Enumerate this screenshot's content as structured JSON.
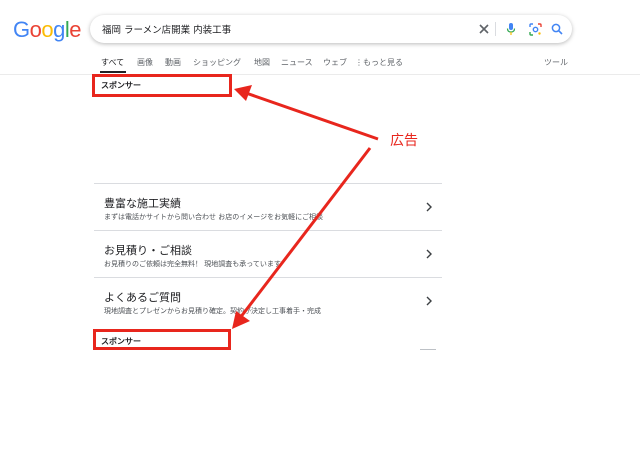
{
  "logo": {
    "letters": [
      "G",
      "o",
      "o",
      "g",
      "l",
      "e"
    ],
    "colors": [
      "#4285F4",
      "#EA4335",
      "#FBBC05",
      "#4285F4",
      "#34A853",
      "#EA4335"
    ]
  },
  "search": {
    "query": "福岡 ラーメン店開業 内装工事",
    "icons": [
      "clear-icon",
      "microphone-icon",
      "camera-lens-icon",
      "search-icon"
    ]
  },
  "tabs": [
    {
      "label": "すべて",
      "active": true
    },
    {
      "label": "画像"
    },
    {
      "label": "動画"
    },
    {
      "label": "ショッピング"
    },
    {
      "label": "地図"
    },
    {
      "label": "ニュース"
    },
    {
      "label": "ウェブ"
    },
    {
      "label": "⋮もっと見る"
    }
  ],
  "tools_label": "ツール",
  "ads": {
    "top_label": "スポンサー",
    "bottom_label": "スポンサー"
  },
  "annotation": {
    "label": "広告",
    "color": "#e8261d"
  },
  "sitelinks": [
    {
      "title": "豊富な施工実績",
      "desc": "まずは電話かサイトから問い合わせ お店のイメージをお気軽にご相談"
    },
    {
      "title": "お見積り・ご相談",
      "desc": "お見積りのご依頼は完全無料！ 現地調査も承っています"
    },
    {
      "title": "よくあるご質問",
      "desc": "現地調査とプレゼンからお見積り確定。契約が決定し工事着手・完成"
    }
  ]
}
